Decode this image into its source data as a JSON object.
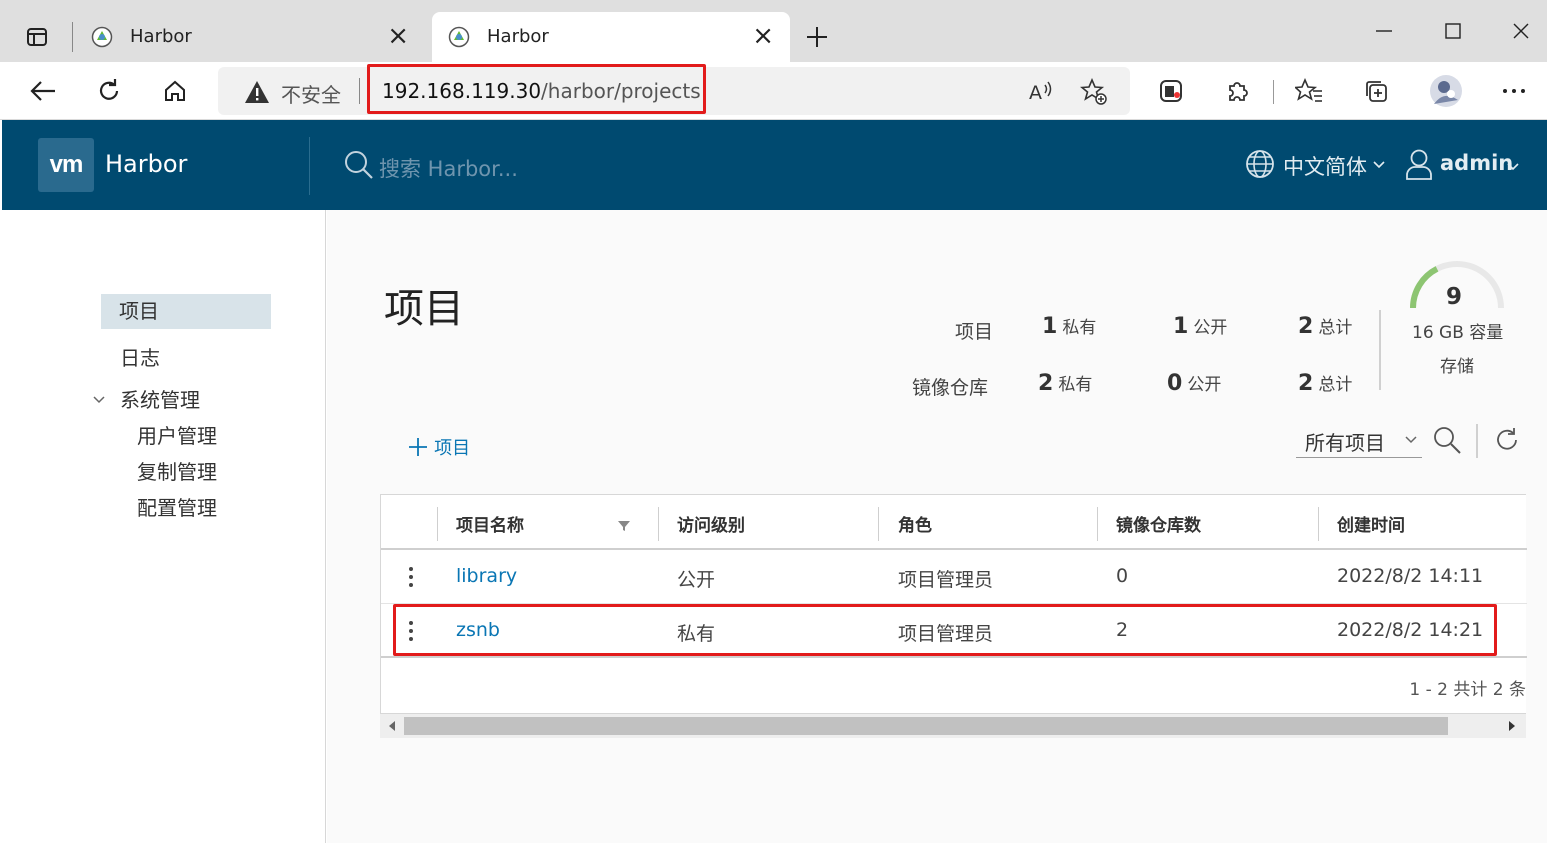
{
  "browser": {
    "tabs": [
      {
        "title": "Harbor",
        "active": false
      },
      {
        "title": "Harbor",
        "active": true
      }
    ],
    "security_label": "不安全",
    "url_host": "192.168.119.30",
    "url_path": "/harbor/projects"
  },
  "header": {
    "logo_text": "vm",
    "brand": "Harbor",
    "search_placeholder": "搜索 Harbor...",
    "language": "中文简体",
    "user": "admin"
  },
  "sidebar": {
    "items": [
      {
        "label": "项目",
        "active": true
      },
      {
        "label": "日志"
      },
      {
        "label": "系统管理",
        "expanded": true
      }
    ],
    "sub_items": [
      {
        "label": "用户管理"
      },
      {
        "label": "复制管理"
      },
      {
        "label": "配置管理"
      }
    ]
  },
  "page": {
    "title": "项目",
    "summary": {
      "projects_label": "项目",
      "repos_label": "镜像仓库",
      "projects_private": "1",
      "projects_public": "1",
      "projects_total": "2",
      "repos_private": "2",
      "repos_public": "0",
      "repos_total": "2",
      "unit_private": "私有",
      "unit_public": "公开",
      "unit_total": "总计"
    },
    "quota": {
      "count": "9",
      "capacity": "16 GB 容量",
      "label": "存储",
      "used_fraction": 0.35
    },
    "add_button": "项目",
    "filter_value": "所有项目"
  },
  "table": {
    "headers": [
      "项目名称",
      "访问级别",
      "角色",
      "镜像仓库数",
      "创建时间"
    ],
    "rows": [
      {
        "name": "library",
        "access": "公开",
        "role": "项目管理员",
        "repos": "0",
        "created": "2022/8/2 14:11"
      },
      {
        "name": "zsnb",
        "access": "私有",
        "role": "项目管理员",
        "repos": "2",
        "created": "2022/8/2 14:21"
      }
    ],
    "footer": "1 - 2 共计 2 条"
  },
  "colors": {
    "header_bg": "#004a70",
    "link": "#0a76b4",
    "highlight": "#e21b1b",
    "gauge": "#8dc572"
  }
}
